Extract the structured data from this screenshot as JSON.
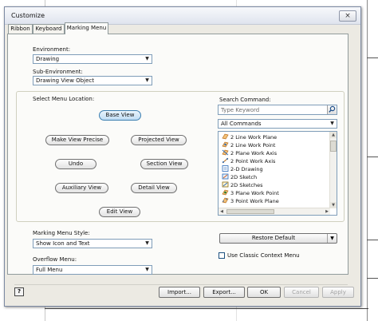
{
  "window": {
    "title": "Customize",
    "close_symbol": "×"
  },
  "tabs": [
    {
      "label": "Ribbon",
      "active": false
    },
    {
      "label": "Keyboard",
      "active": false
    },
    {
      "label": "Marking Menu",
      "active": true
    }
  ],
  "environment": {
    "label": "Environment:",
    "value": "Drawing"
  },
  "sub_environment": {
    "label": "Sub-Environment:",
    "value": "Drawing View Object"
  },
  "menu_location": {
    "label": "Select Menu Location:",
    "buttons": {
      "center": "Base View",
      "left_top": "Make View Precise",
      "right_top": "Projected View",
      "left_mid": "Undo",
      "right_mid": "Section View",
      "left_bottom": "Auxiliary View",
      "right_bottom": "Detail View",
      "bottom": "Edit View"
    }
  },
  "search": {
    "label": "Search Command:",
    "placeholder": "Type Keyword",
    "filter": "All Commands",
    "commands": [
      "2 Line Work Plane",
      "2 Line Work Point",
      "2 Plane Work Axis",
      "2 Point Work Axis",
      "2-D Drawing",
      "2D Sketch",
      "2D Sketches",
      "3 Plane Work Point",
      "3 Point Work Plane"
    ]
  },
  "marking_menu_style": {
    "label": "Marking Menu Style:",
    "value": "Show Icon and Text"
  },
  "overflow_menu": {
    "label": "Overflow Menu:",
    "value": "Full Menu"
  },
  "restore_default": "Restore Default",
  "classic_context_menu": {
    "label": "Use Classic Context Menu",
    "checked": false
  },
  "footer": {
    "help": "?",
    "import": "Import...",
    "export": "Export...",
    "ok": "OK",
    "cancel": "Cancel",
    "apply": "Apply"
  },
  "colors": {
    "selected_button": "#bfdcf4",
    "dialog_bg": "#eceae3",
    "accent_border": "#7f9db9"
  }
}
